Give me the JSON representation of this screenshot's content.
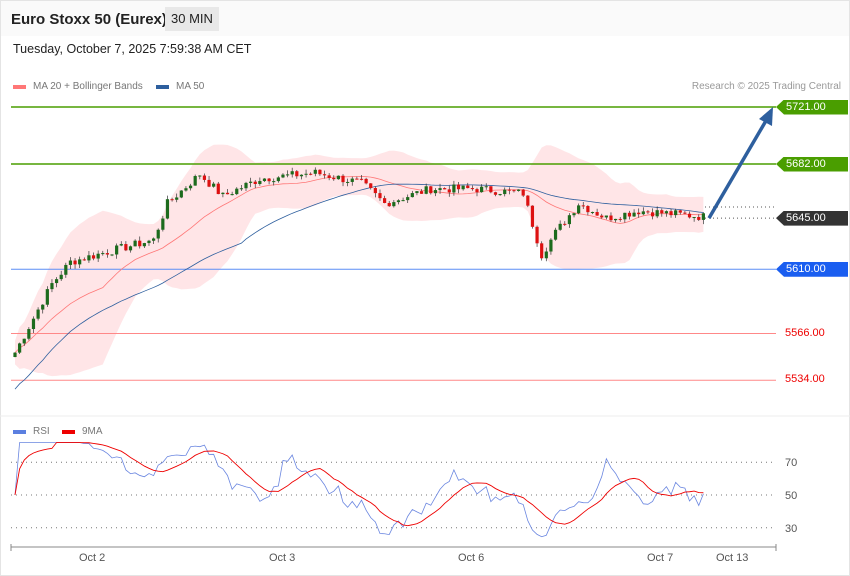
{
  "header": {
    "title": "Euro Stoxx 50 (Eurex)",
    "timeframe": "30 MIN",
    "datetime": "Tuesday, October 7, 2025 7:59:38 AM CET",
    "copyright": "Research © 2025 Trading Central"
  },
  "legend": {
    "ma20": "MA 20 + Bollinger Bands",
    "ma50": "MA 50",
    "rsi": "RSI",
    "rsi_ma": "9MA"
  },
  "colors": {
    "green": "#4a9e00",
    "blue": "#1a5ef0",
    "red": "#e00",
    "dark": "#333",
    "arrow": "#2e5f9e",
    "ma20": "#f77",
    "ma50": "#2e5f9e",
    "bands": "#ffe0e3"
  },
  "chart_data": [
    {
      "type": "candlestick",
      "title": "Euro Stoxx 50 (Eurex) 30 MIN",
      "ylim": [
        5520,
        5730
      ],
      "levels": [
        {
          "value": 5721,
          "label": "5721.00",
          "kind": "resistance"
        },
        {
          "value": 5682,
          "label": "5682.00",
          "kind": "resistance"
        },
        {
          "value": 5645,
          "label": "5645.00",
          "kind": "last"
        },
        {
          "value": 5610,
          "label": "5610.00",
          "kind": "pivot"
        },
        {
          "value": 5566,
          "label": "5566.00",
          "kind": "support"
        },
        {
          "value": 5534,
          "label": "5534.00",
          "kind": "support"
        }
      ],
      "approx_close_path": [
        [
          0,
          5553
        ],
        [
          8,
          5600
        ],
        [
          12,
          5615
        ],
        [
          20,
          5622
        ],
        [
          30,
          5630
        ],
        [
          33,
          5655
        ],
        [
          40,
          5675
        ],
        [
          45,
          5660
        ],
        [
          53,
          5672
        ],
        [
          65,
          5676
        ],
        [
          75,
          5669
        ],
        [
          80,
          5655
        ],
        [
          90,
          5665
        ],
        [
          100,
          5665
        ],
        [
          110,
          5662
        ],
        [
          114,
          5620
        ],
        [
          117,
          5635
        ],
        [
          122,
          5655
        ],
        [
          128,
          5645
        ],
        [
          135,
          5650
        ],
        [
          149,
          5646
        ]
      ],
      "target_arrow": {
        "from": 5645,
        "to": 5721
      },
      "xticks": [
        "Oct 2",
        "Oct 3",
        "Oct 6",
        "Oct 7",
        "Oct 13"
      ]
    },
    {
      "type": "line",
      "title": "RSI",
      "yticks": [
        70,
        50,
        30
      ],
      "ylim": [
        15,
        85
      ]
    }
  ]
}
